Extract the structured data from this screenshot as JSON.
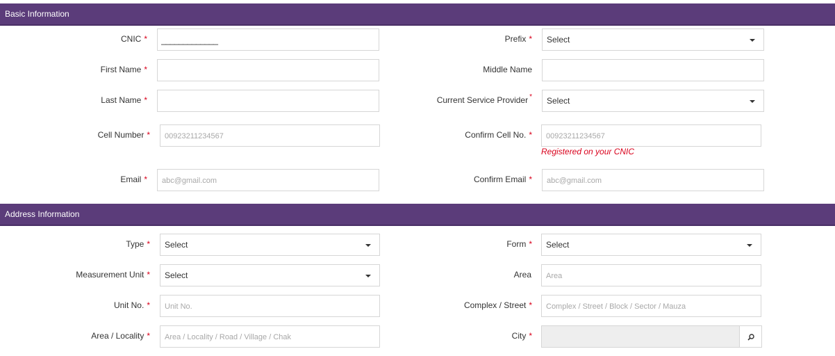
{
  "basic": {
    "title": "Basic Information",
    "cnic": {
      "label": "CNIC",
      "value": "_____________"
    },
    "prefix": {
      "label": "Prefix",
      "value": "Select"
    },
    "first_name": {
      "label": "First Name",
      "value": ""
    },
    "middle_name": {
      "label": "Middle Name",
      "value": ""
    },
    "last_name": {
      "label": "Last Name",
      "value": ""
    },
    "service_provider": {
      "label": "Current Service Provider",
      "value": "Select"
    },
    "cell": {
      "label": "Cell Number",
      "placeholder": "00923211234567"
    },
    "confirm_cell": {
      "label": "Confirm Cell No.",
      "placeholder": "00923211234567",
      "hint": "Registered on your CNIC"
    },
    "email": {
      "label": "Email",
      "placeholder": "abc@gmail.com"
    },
    "confirm_email": {
      "label": "Confirm Email",
      "placeholder": "abc@gmail.com"
    },
    "required_mark": "*"
  },
  "address": {
    "title": "Address Information",
    "type": {
      "label": "Type",
      "value": "Select"
    },
    "form": {
      "label": "Form",
      "value": "Select"
    },
    "measurement_unit": {
      "label": "Measurement Unit",
      "value": "Select"
    },
    "area": {
      "label": "Area",
      "placeholder": "Area"
    },
    "unit_no": {
      "label": "Unit No.",
      "placeholder": "Unit No."
    },
    "complex_street": {
      "label": "Complex / Street",
      "placeholder": "Complex / Street / Block / Sector / Mauza"
    },
    "area_locality": {
      "label": "Area / Locality",
      "placeholder": "Area / Locality / Road / Village / Chak"
    },
    "city": {
      "label": "City",
      "value": ""
    },
    "required_mark": "*"
  },
  "colors": {
    "header": "#5b3c7a",
    "required": "#d9001b",
    "border": "#d6d6d6"
  },
  "icons": {
    "dropdown": "chevron-down-icon",
    "search": "search-icon"
  }
}
